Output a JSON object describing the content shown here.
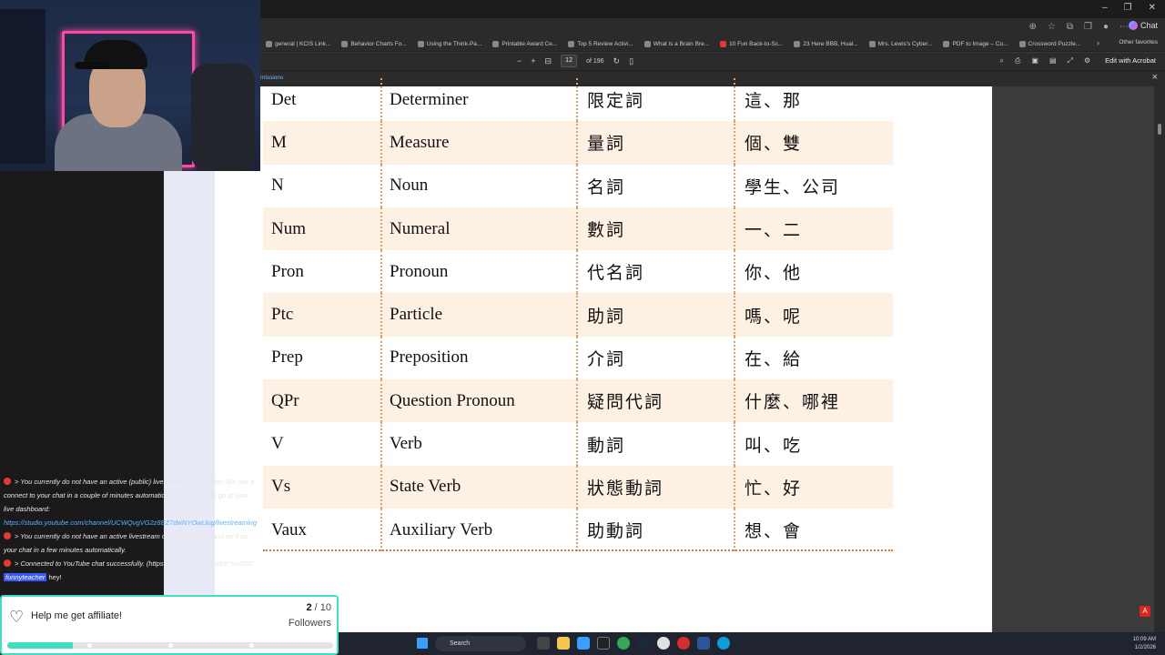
{
  "browser": {
    "favorites": [
      "general | KCIS Link...",
      "Behavior Charts Fo...",
      "Using the Think-Pa...",
      "Printable Award Ce...",
      "Top 5 Review Activi...",
      "What is a Brain Bre...",
      "10 Fun Back-to-Sc...",
      "23 Here BBB, Hual...",
      "Mrs. Lewis's Cyber...",
      "PDF to Image – Co...",
      "Crossword Puzzle..."
    ],
    "other_favorites": "Other favorites",
    "chat_label": "Chat",
    "permissions_text": "missions"
  },
  "pdf": {
    "page_current": "12",
    "page_total": "of 196",
    "edit_label": "Edit with Acrobat"
  },
  "table": {
    "rows": [
      {
        "abbr": "Det",
        "en": "Determiner",
        "zh": "限定詞",
        "ex": "這、那"
      },
      {
        "abbr": "M",
        "en": "Measure",
        "zh": "量詞",
        "ex": "個、雙"
      },
      {
        "abbr": "N",
        "en": "Noun",
        "zh": "名詞",
        "ex": "學生、公司"
      },
      {
        "abbr": "Num",
        "en": "Numeral",
        "zh": "數詞",
        "ex": "一、二"
      },
      {
        "abbr": "Pron",
        "en": "Pronoun",
        "zh": "代名詞",
        "ex": "你、他"
      },
      {
        "abbr": "Ptc",
        "en": "Particle",
        "zh": "助詞",
        "ex": "嗎、呢"
      },
      {
        "abbr": "Prep",
        "en": "Preposition",
        "zh": "介詞",
        "ex": "在、給"
      },
      {
        "abbr": "QPr",
        "en": "Question Pronoun",
        "zh": "疑問代詞",
        "ex": "什麼、哪裡"
      },
      {
        "abbr": "V",
        "en": "Verb",
        "zh": "動詞",
        "ex": "叫、吃"
      },
      {
        "abbr": "Vs",
        "en": "State Verb",
        "zh": "狀態動詞",
        "ex": "忙、好"
      },
      {
        "abbr": "Vaux",
        "en": "Auxiliary Verb",
        "zh": "助動詞",
        "ex": "想、會"
      }
    ]
  },
  "chat": {
    "lines": [
      "> You currently do not have an active (public) livestream on YouTube. We live a",
      "connect to your chat in a couple of minutes automatically. Click here to go to your",
      "live dashboard:",
      "https://studio.youtube.com/channel/UCWQvgVG2z8EZ7dwNYOwLlug/livestreaming",
      "> You currently do not have an active livestream on Kick. We live and we'll co",
      "your chat in a few minutes automatically.",
      "> Connected to YouTube chat successfully. (https://youtube.com/watch?v=GFC"
    ],
    "last_user": "funnyteacher",
    "last_message": "hey!"
  },
  "affiliate": {
    "label": "Help me get affiliate!",
    "current": "2",
    "goal": "/ 10",
    "unit": "Followers",
    "progress_fraction": 0.2
  },
  "taskbar": {
    "search_placeholder": "Search",
    "time": "10:09 AM",
    "date": "1/2/2026"
  },
  "colors": {
    "row_shade": "#fdf1e4",
    "divider": "#e0a070",
    "affiliate_accent": "#3fe0c0"
  }
}
